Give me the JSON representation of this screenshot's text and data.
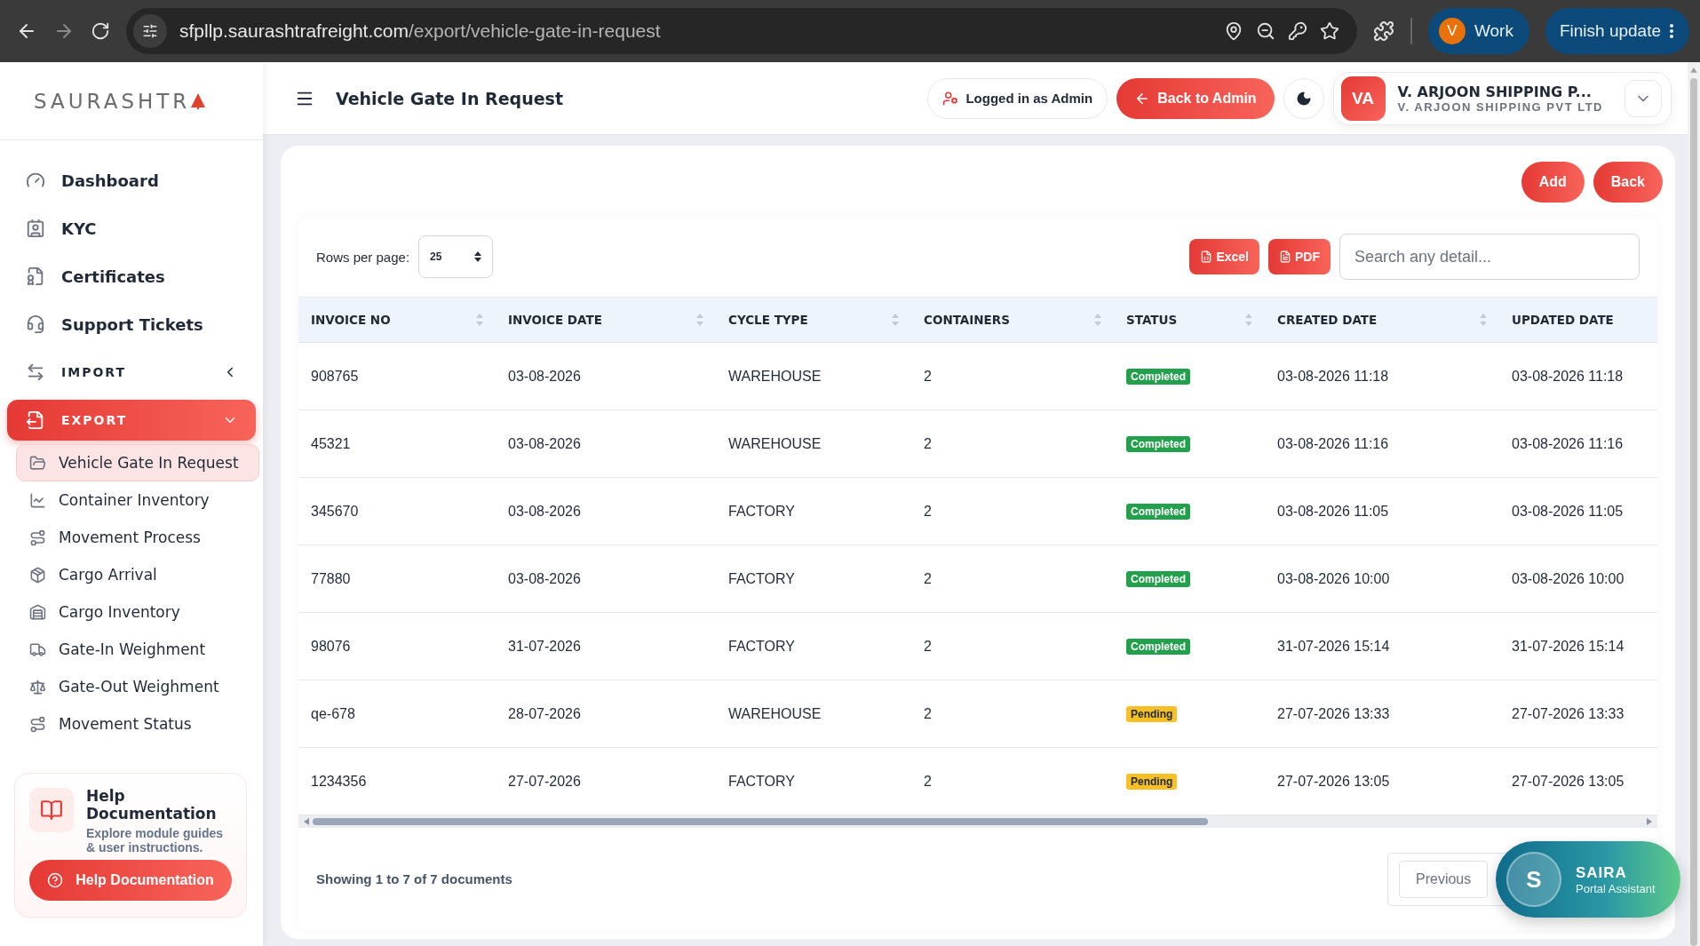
{
  "browser": {
    "url_host": "sfpllp.saurashtrafreight.com",
    "url_path": "/export/vehicle-gate-in-request",
    "profile": {
      "initial": "V",
      "label": "Work"
    },
    "update_button": "Finish update"
  },
  "sidebar": {
    "logo": "SAURASHTR",
    "items": [
      {
        "kind": "link",
        "label": "Dashboard"
      },
      {
        "kind": "link",
        "label": "KYC"
      },
      {
        "kind": "link",
        "label": "Certificates"
      },
      {
        "kind": "link",
        "label": "Support Tickets"
      },
      {
        "kind": "section",
        "label": "IMPORT",
        "expanded": false,
        "selected": false
      },
      {
        "kind": "section",
        "label": "EXPORT",
        "expanded": true,
        "selected": true,
        "children": [
          {
            "label": "Vehicle Gate In Request",
            "selected": true
          },
          {
            "label": "Container Inventory",
            "selected": false
          },
          {
            "label": "Movement Process",
            "selected": false
          },
          {
            "label": "Cargo Arrival",
            "selected": false
          },
          {
            "label": "Cargo Inventory",
            "selected": false
          },
          {
            "label": "Gate-In Weighment",
            "selected": false
          },
          {
            "label": "Gate-Out Weighment",
            "selected": false
          },
          {
            "label": "Movement Status",
            "selected": false
          }
        ]
      }
    ],
    "help": {
      "title": "Help Documentation",
      "text": "Explore module guides & user instructions.",
      "button": "Help Documentation"
    }
  },
  "header": {
    "title": "Vehicle Gate In Request",
    "logged_in": "Logged in as Admin",
    "back_to_admin": "Back to Admin",
    "account": {
      "initials": "VA",
      "name": "V. ARJOON SHIPPING P...",
      "company": "V. ARJOON SHIPPING PVT LTD"
    }
  },
  "actions": {
    "add": "Add",
    "back": "Back"
  },
  "toolbar": {
    "rows_label": "Rows per page:",
    "rows_value": "25",
    "excel": "Excel",
    "pdf": "PDF",
    "search_placeholder": "Search any detail..."
  },
  "table": {
    "columns": [
      "INVOICE NO",
      "INVOICE DATE",
      "CYCLE TYPE",
      "CONTAINERS",
      "STATUS",
      "CREATED DATE",
      "UPDATED DATE"
    ],
    "rows": [
      {
        "invoice_no": "908765",
        "invoice_date": "03-08-2026",
        "cycle_type": "WAREHOUSE",
        "containers": "2",
        "status": "Completed",
        "color": "#22a04b",
        "created": "03-08-2026 11:18",
        "updated": "03-08-2026 11:18"
      },
      {
        "invoice_no": "45321",
        "invoice_date": "03-08-2026",
        "cycle_type": "WAREHOUSE",
        "containers": "2",
        "status": "Completed",
        "color": "#22a04b",
        "created": "03-08-2026 11:16",
        "updated": "03-08-2026 11:16"
      },
      {
        "invoice_no": "345670",
        "invoice_date": "03-08-2026",
        "cycle_type": "FACTORY",
        "containers": "2",
        "status": "Completed",
        "color": "#22a04b",
        "created": "03-08-2026 11:05",
        "updated": "03-08-2026 11:05"
      },
      {
        "invoice_no": "77880",
        "invoice_date": "03-08-2026",
        "cycle_type": "FACTORY",
        "containers": "2",
        "status": "Completed",
        "color": "#22a04b",
        "created": "03-08-2026 10:00",
        "updated": "03-08-2026 10:00"
      },
      {
        "invoice_no": "98076",
        "invoice_date": "31-07-2026",
        "cycle_type": "FACTORY",
        "containers": "2",
        "status": "Completed",
        "color": "#22a04b",
        "created": "31-07-2026 15:14",
        "updated": "31-07-2026 15:14"
      },
      {
        "invoice_no": "qe-678",
        "invoice_date": "28-07-2026",
        "cycle_type": "WAREHOUSE",
        "containers": "2",
        "status": "Pending",
        "color": "#f6c026",
        "created": "27-07-2026 13:33",
        "updated": "27-07-2026 13:33"
      },
      {
        "invoice_no": "1234356",
        "invoice_date": "27-07-2026",
        "cycle_type": "FACTORY",
        "containers": "2",
        "status": "Pending",
        "color": "#f6c026",
        "created": "27-07-2026 13:05",
        "updated": "27-07-2026 13:05"
      }
    ]
  },
  "footer": {
    "summary": "Showing 1 to 7 of 7 documents",
    "previous": "Previous"
  },
  "assistant": {
    "initial": "S",
    "name": "SAIRA",
    "role": "Portal Assistant"
  }
}
